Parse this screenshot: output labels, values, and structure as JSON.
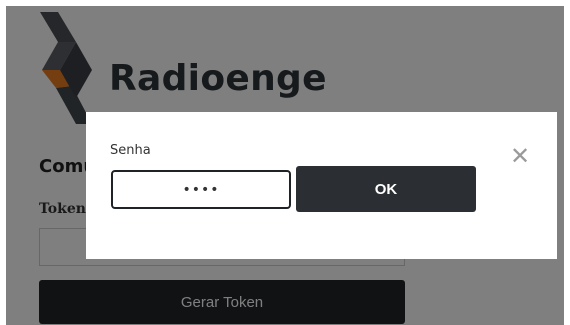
{
  "brand": {
    "name": "Radioenge",
    "logo_icon": "radioenge-logo-icon"
  },
  "page": {
    "section_title": "Comu",
    "token_label": "Token",
    "token_value": "",
    "generate_button": "Gerar Token"
  },
  "modal": {
    "password_label": "Senha",
    "password_value": "••••",
    "ok_button": "OK",
    "close_symbol": "✕",
    "close_icon": "close-icon"
  },
  "colors": {
    "dark_button": "#202427",
    "ok_button": "#2b2f33",
    "logo_orange": "#e97d22",
    "overlay": "rgba(0,0,0,0.5)"
  }
}
